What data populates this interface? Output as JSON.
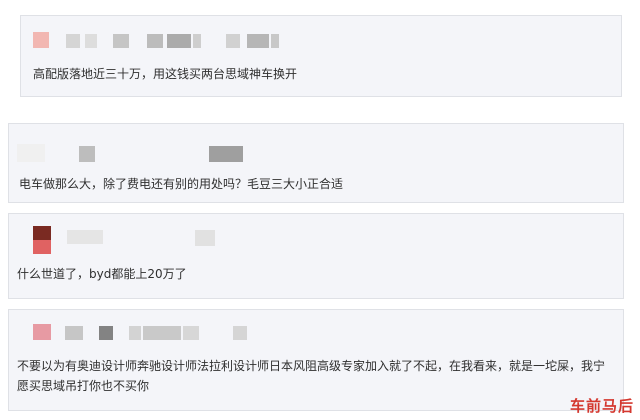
{
  "comments": [
    {
      "text": "高配版落地近三十万，用这钱买两台思域神车换开",
      "avatar_color": "#f2b7b2"
    },
    {
      "text": "电车做那么大，除了费电还有别的用处吗？毛豆三大小正合适",
      "avatar_color": "#d9d9d9"
    },
    {
      "text": "什么世道了，byd都能上20万了",
      "avatar_color": "#7a2a22"
    },
    {
      "text": "不要以为有奥迪设计师奔驰设计师法拉利设计师日本风阻高级专家加入就了不起，在我看来，就是一坨屎，我宁愿买思域吊打你也不买你",
      "avatar_color": "#e79aa3"
    }
  ],
  "watermark": "车前马后"
}
